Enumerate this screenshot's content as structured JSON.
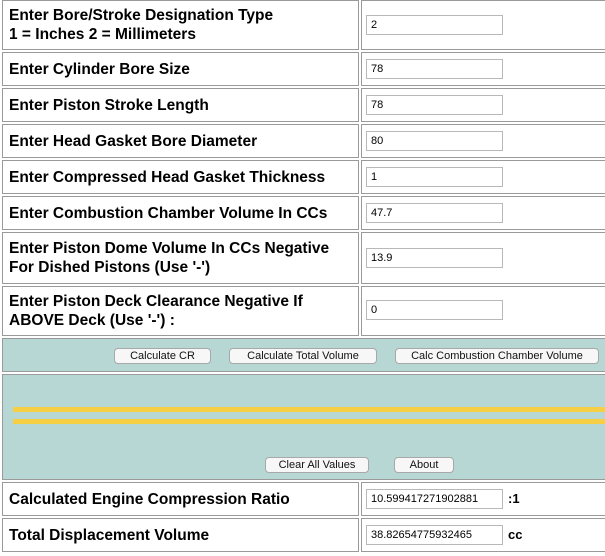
{
  "rows": [
    {
      "label_line1": "Enter Bore/Stroke Designation Type",
      "label_line2": "1 = Inches 2 = Millimeters",
      "value": "2"
    },
    {
      "label_line1": "Enter Cylinder Bore Size",
      "value": "78"
    },
    {
      "label_line1": "Enter Piston Stroke Length",
      "value": "78"
    },
    {
      "label_line1": "Enter Head Gasket Bore Diameter",
      "value": "80"
    },
    {
      "label_line1": "Enter Compressed Head Gasket Thickness",
      "value": "1"
    },
    {
      "label_line1": "Enter Combustion Chamber Volume In CCs",
      "value": "47.7"
    },
    {
      "label_line1": "Enter Piston Dome Volume In CCs Negative",
      "label_line2": "For Dished Pistons (Use '-')",
      "value": "13.9"
    },
    {
      "label_line1": "Enter Piston Deck Clearance Negative If",
      "label_line2": "ABOVE Deck (Use '-') :",
      "value": "0"
    }
  ],
  "buttons": {
    "calc_cr": "Calculate CR",
    "calc_total_volume": "Calculate Total Volume",
    "calc_chamber_volume": "Calc Combustion Chamber Volume",
    "clear_all": "Clear All Values",
    "about": "About"
  },
  "results": {
    "compression_ratio": {
      "label": "Calculated Engine Compression Ratio",
      "value": "10.599417271902881",
      "unit": ":1"
    },
    "total_displacement": {
      "label": "Total Displacement Volume",
      "value": "38.82654775932465",
      "unit": "cc"
    }
  },
  "colors": {
    "panel_bg": "#b6d7d4",
    "stripe": "#f6cf45"
  }
}
